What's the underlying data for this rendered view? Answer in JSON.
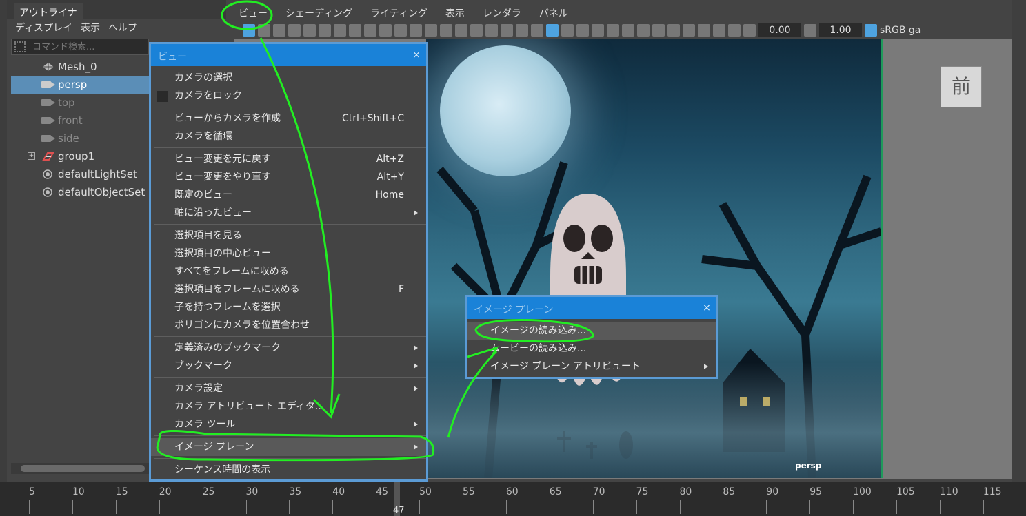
{
  "outliner": {
    "tab": "アウトライナ",
    "menu": [
      "ディスプレイ",
      "表示",
      "ヘルプ"
    ],
    "search_placeholder": "コマンド検索...",
    "items": [
      {
        "label": "Mesh_0"
      },
      {
        "label": "persp"
      },
      {
        "label": "top"
      },
      {
        "label": "front"
      },
      {
        "label": "side"
      },
      {
        "label": "group1"
      },
      {
        "label": "defaultLightSet"
      },
      {
        "label": "defaultObjectSet"
      }
    ]
  },
  "viewport": {
    "menu": [
      "ビュー",
      "シェーディング",
      "ライティング",
      "表示",
      "レンダラ",
      "パネル"
    ],
    "field1": "0.00",
    "field2": "1.00",
    "colorspace": "sRGB ga",
    "camera_label": "persp",
    "view_cube_label": "前"
  },
  "view_menu": {
    "title": "ビュー",
    "items": [
      {
        "label": "カメラの選択"
      },
      {
        "label": "カメラをロック"
      },
      {
        "label": "ビューからカメラを作成",
        "shortcut": "Ctrl+Shift+C"
      },
      {
        "label": "カメラを循環"
      },
      {
        "label": "ビュー変更を元に戻す",
        "shortcut": "Alt+Z"
      },
      {
        "label": "ビュー変更をやり直す",
        "shortcut": "Alt+Y"
      },
      {
        "label": "既定のビュー",
        "shortcut": "Home"
      },
      {
        "label": "軸に沿ったビュー"
      },
      {
        "label": "選択項目を見る"
      },
      {
        "label": "選択項目の中心ビュー"
      },
      {
        "label": "すべてをフレームに収める"
      },
      {
        "label": "選択項目をフレームに収める",
        "shortcut": "F"
      },
      {
        "label": "子を持つフレームを選択"
      },
      {
        "label": "ポリゴンにカメラを位置合わせ"
      },
      {
        "label": "定義済みのブックマーク"
      },
      {
        "label": "ブックマーク"
      },
      {
        "label": "カメラ設定"
      },
      {
        "label": "カメラ アトリビュート エディタ..."
      },
      {
        "label": "カメラ ツール"
      },
      {
        "label": "イメージ プレーン"
      },
      {
        "label": "シーケンス時間の表示"
      }
    ]
  },
  "image_plane_menu": {
    "title": "イメージ プレーン",
    "items": [
      {
        "label": "イメージの読み込み..."
      },
      {
        "label": "ムービーの読み込み..."
      },
      {
        "label": "イメージ プレーン アトリビュート"
      }
    ]
  },
  "timeline": {
    "ticks": [
      "5",
      "10",
      "15",
      "20",
      "25",
      "30",
      "35",
      "40",
      "45",
      "50",
      "55",
      "60",
      "65",
      "70",
      "75",
      "80",
      "85",
      "90",
      "95",
      "100",
      "105",
      "110",
      "115"
    ],
    "current": "47"
  },
  "colors": {
    "menu_title_bg": "#1a82d8",
    "selection": "#5b8eb7",
    "annotation": "#22ee22"
  }
}
